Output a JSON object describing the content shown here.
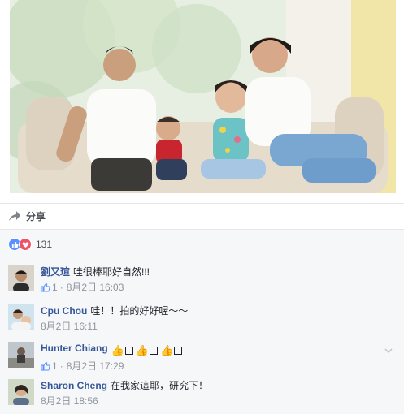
{
  "post": {
    "share_label": "分享",
    "reaction_count": "131",
    "reactions": [
      "like-icon",
      "love-icon"
    ]
  },
  "colors": {
    "author_link": "#365899",
    "meta_gray": "#90949c",
    "comments_bg": "#f6f7f9",
    "like_blue": "#5890ff",
    "love_red": "#f25268"
  },
  "comments": [
    {
      "author": "劉又瑄",
      "text": "哇很棒耶好自然!!!",
      "likes": "1",
      "date": "8月2日 16:03"
    },
    {
      "author": "Cpu Chou",
      "text": "哇！！拍的好好喔～～",
      "likes": "",
      "date": "8月2日 16:11"
    },
    {
      "author": "Hunter Chiang",
      "text": "",
      "emoji": [
        "thumbs-up",
        "box",
        "thumbs-up",
        "box",
        "thumbs-up",
        "box"
      ],
      "likes": "1",
      "date": "8月2日 17:29"
    },
    {
      "author": "Sharon Cheng",
      "text": "在我家這耶，研究下！",
      "likes": "",
      "date": "8月2日 18:56"
    }
  ]
}
